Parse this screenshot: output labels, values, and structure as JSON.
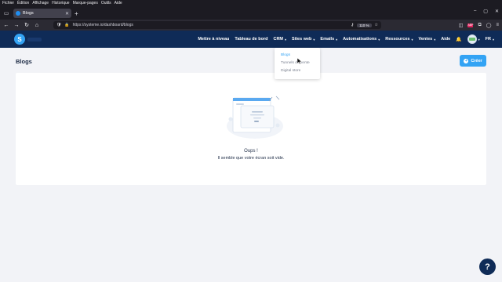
{
  "os_menu": [
    "Fichier",
    "Édition",
    "Affichage",
    "Historique",
    "Marque-pages",
    "Outils",
    "Aide"
  ],
  "browser": {
    "tab_title": "Blogs",
    "url": "https://systeme.io/dashboard/blogs",
    "zoom": "110 %",
    "ext_badge": "ABP"
  },
  "app": {
    "logo_letter": "S",
    "nav": [
      {
        "label": "Mettre à niveau",
        "chevron": false
      },
      {
        "label": "Tableau de bord",
        "chevron": false
      },
      {
        "label": "CRM",
        "chevron": true
      },
      {
        "label": "Sites web",
        "chevron": true
      },
      {
        "label": "Emails",
        "chevron": true
      },
      {
        "label": "Automatisations",
        "chevron": true
      },
      {
        "label": "Ressources",
        "chevron": true
      },
      {
        "label": "Ventes",
        "chevron": true
      },
      {
        "label": "Aide",
        "chevron": false
      }
    ],
    "language": "FR"
  },
  "dropdown": {
    "items": [
      "Blogs",
      "Tunnels de vente",
      "Digital store"
    ]
  },
  "page": {
    "title": "Blogs",
    "create_label": "Créer",
    "empty_title": "Oups !",
    "empty_subtitle": "Il semble que votre écran soit vide."
  },
  "help_label": "?",
  "colors": {
    "header_bg": "#0f2b57",
    "accent": "#33a3f4",
    "page_bg": "#f2f3f7"
  }
}
